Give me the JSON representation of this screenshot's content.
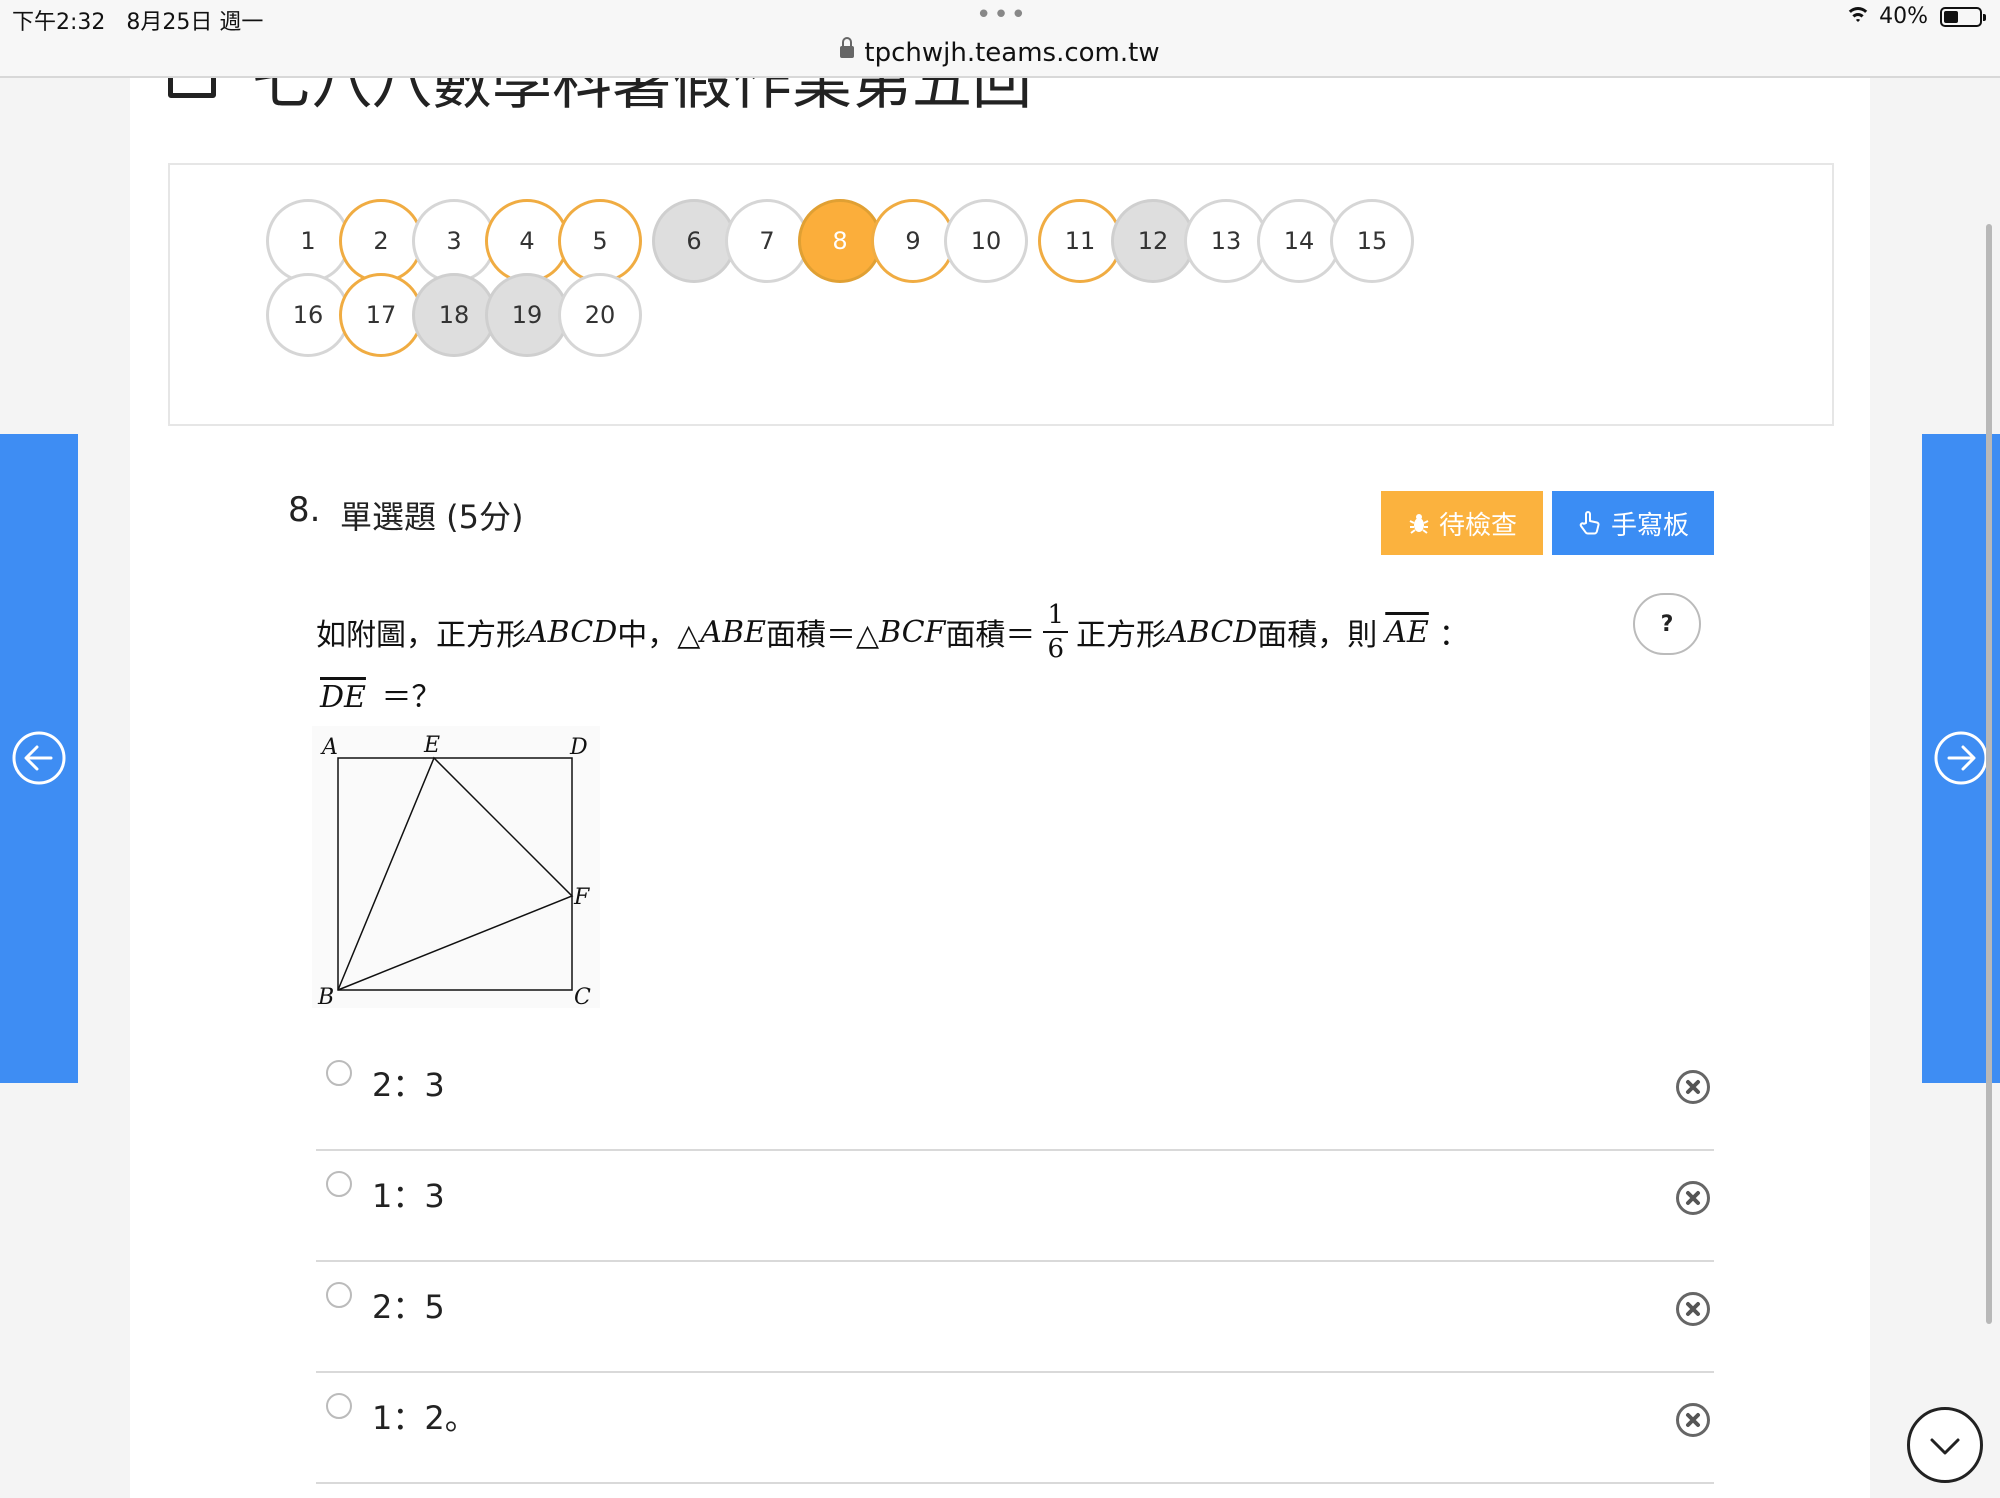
{
  "status_bar": {
    "time": "下午2:32",
    "date": "8月25日 週一",
    "url": "tpchwjh.teams.com.tw",
    "battery": "40%"
  },
  "page": {
    "title": "七八八數學科暑假作業第五回"
  },
  "navigator": {
    "questions": [
      {
        "n": "1",
        "state": "unanswered"
      },
      {
        "n": "2",
        "state": "marked"
      },
      {
        "n": "3",
        "state": "unanswered"
      },
      {
        "n": "4",
        "state": "marked"
      },
      {
        "n": "5",
        "state": "marked"
      },
      {
        "n": "6",
        "state": "answered"
      },
      {
        "n": "7",
        "state": "unanswered"
      },
      {
        "n": "8",
        "state": "current"
      },
      {
        "n": "9",
        "state": "marked"
      },
      {
        "n": "10",
        "state": "unanswered"
      },
      {
        "n": "11",
        "state": "marked"
      },
      {
        "n": "12",
        "state": "answered"
      },
      {
        "n": "13",
        "state": "unanswered"
      },
      {
        "n": "14",
        "state": "unanswered"
      },
      {
        "n": "15",
        "state": "unanswered"
      },
      {
        "n": "16",
        "state": "unanswered"
      },
      {
        "n": "17",
        "state": "marked"
      },
      {
        "n": "18",
        "state": "answered"
      },
      {
        "n": "19",
        "state": "answered"
      },
      {
        "n": "20",
        "state": "unanswered"
      }
    ]
  },
  "question": {
    "number": "8.",
    "type": "單選題 (5分)",
    "review_label": "待檢查",
    "handwriting_label": "手寫板",
    "help_label": "?",
    "text": {
      "p1": "如附圖，正方形",
      "m1": "ABCD",
      "p2": "中，△",
      "m2": "ABE",
      "p3": "面積＝△",
      "m3": "BCF",
      "p4": "面積＝",
      "frac_num": "1",
      "frac_den": "6",
      "p5": "正方形",
      "m4": "ABCD",
      "p6": "面積，則",
      "seg1": "AE",
      "colon": "：",
      "seg2": "DE",
      "tail": "＝？"
    },
    "figure": {
      "labels": {
        "a": "A",
        "e": "E",
        "d": "D",
        "f": "F",
        "b": "B",
        "c": "C"
      }
    },
    "options": [
      {
        "label": "2：3"
      },
      {
        "label": "1：3"
      },
      {
        "label": "2：5"
      },
      {
        "label": "1：2。"
      }
    ]
  },
  "colors": {
    "accent_blue": "#3e8df3",
    "review_orange": "#fbb23e",
    "current_orange": "#fbae3b",
    "marked_border": "#f0ac42"
  },
  "icons": {
    "prev": "arrow-left-circle-icon",
    "next": "arrow-right-circle-icon",
    "review": "bug-icon",
    "handwriting": "hand-pointer-icon",
    "remove_option": "x-circle-icon",
    "scroll_down": "chevron-down-icon"
  }
}
